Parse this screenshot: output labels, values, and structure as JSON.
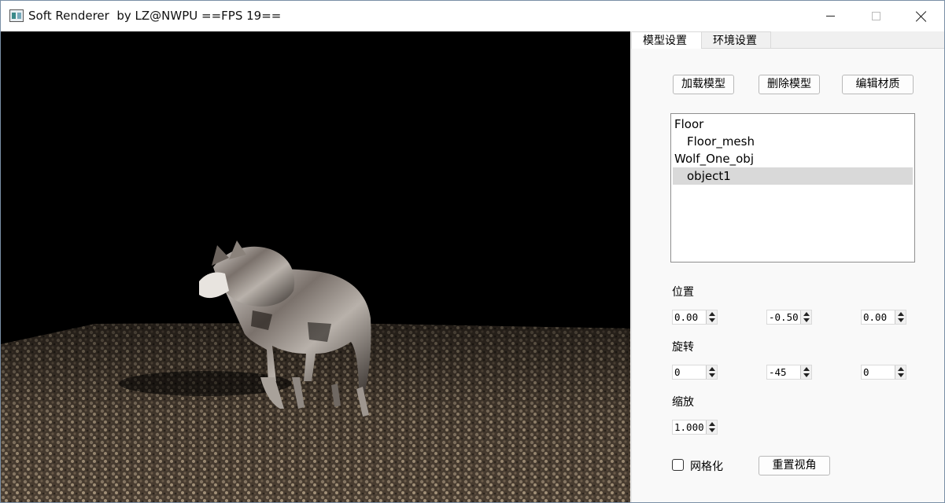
{
  "window": {
    "title": "Soft Renderer  by LZ@NWPU ==FPS 19==",
    "controls": [
      "minimize-icon",
      "maximize-icon",
      "close-icon"
    ]
  },
  "tabs": [
    {
      "label": "模型设置",
      "active": true
    },
    {
      "label": "环境设置",
      "active": false
    }
  ],
  "model_buttons": {
    "load": "加载模型",
    "delete": "删除模型",
    "edit_material": "编辑材质"
  },
  "tree": [
    {
      "label": "Floor",
      "level": 0,
      "selected": false
    },
    {
      "label": "Floor_mesh",
      "level": 1,
      "selected": false
    },
    {
      "label": "Wolf_One_obj",
      "level": 0,
      "selected": false
    },
    {
      "label": "object1",
      "level": 1,
      "selected": true
    }
  ],
  "position": {
    "label": "位置",
    "x": "0.00",
    "y": "-0.50",
    "z": "0.00"
  },
  "rotation": {
    "label": "旋转",
    "x": "0",
    "y": "-45",
    "z": "0"
  },
  "scale": {
    "label": "缩放",
    "value": "1.000"
  },
  "wireframe": {
    "label": "网格化",
    "checked": false
  },
  "reset_view": "重置视角",
  "colors": {
    "viewport_bg": "#000000",
    "panel_bg": "#f9f9f9",
    "selection": "#d9d9d9"
  }
}
